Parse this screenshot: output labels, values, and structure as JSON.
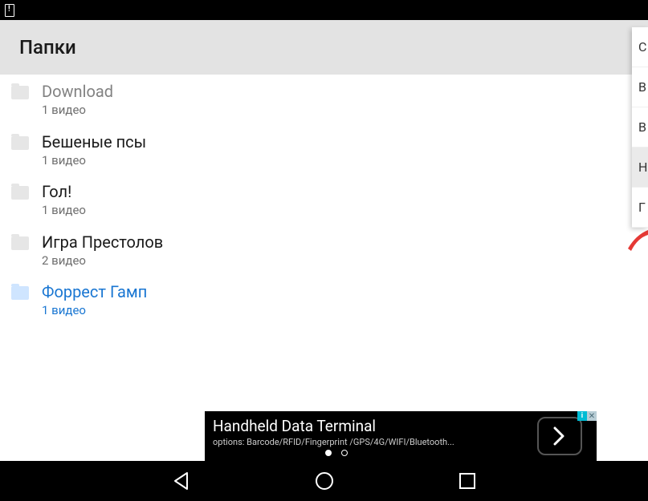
{
  "header": {
    "title": "Папки"
  },
  "folders": [
    {
      "name": "Download",
      "subtitle": "1 видео",
      "dimmed": true,
      "highlighted": false
    },
    {
      "name": "Бешеные псы",
      "subtitle": "1 видео",
      "dimmed": false,
      "highlighted": false
    },
    {
      "name": "Гол!",
      "subtitle": "1 видео",
      "dimmed": false,
      "highlighted": false
    },
    {
      "name": "Игра Престолов",
      "subtitle": "2 видео",
      "dimmed": false,
      "highlighted": false
    },
    {
      "name": "Форрест Гамп",
      "subtitle": "1 видео",
      "dimmed": false,
      "highlighted": true
    }
  ],
  "side_menu": [
    {
      "label": "С",
      "selected": false
    },
    {
      "label": "В",
      "selected": false
    },
    {
      "label": "В",
      "selected": false
    },
    {
      "label": "Н",
      "selected": true
    },
    {
      "label": "Г",
      "selected": false
    }
  ],
  "ad": {
    "title": "Handheld Data Terminal",
    "options": "options: Barcode/RFID/Fingerprint /GPS/4G/WIFI/Bluetooth..."
  }
}
